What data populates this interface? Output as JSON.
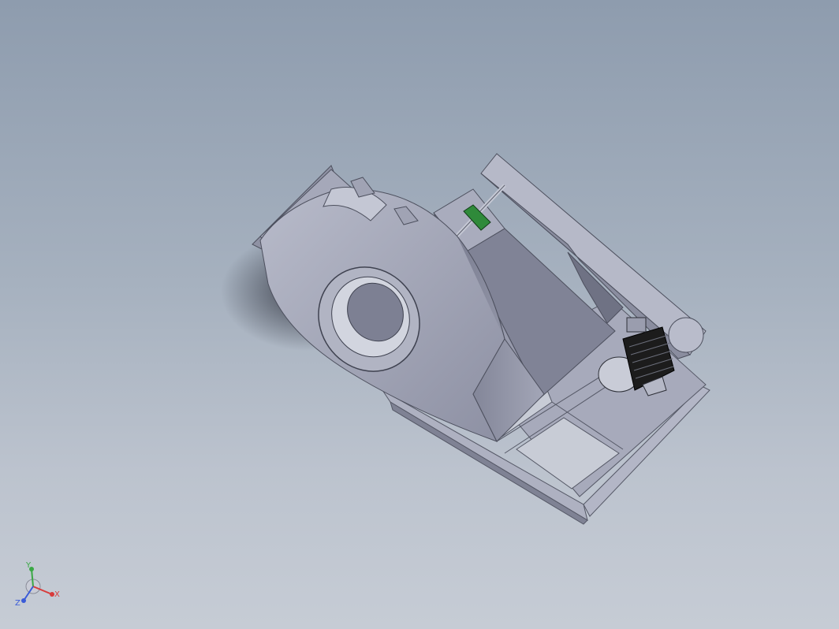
{
  "viewport": {
    "background_top": "#8e9cae",
    "background_bottom": "#c6ccd5"
  },
  "model": {
    "body_color": "#9a9dae",
    "body_dark": "#6e7082",
    "body_light": "#b9bccb",
    "bearing_color": "#2f8a3a",
    "motor_color": "#1c1c1c"
  },
  "triad": {
    "x_label": "X",
    "y_label": "Y",
    "z_label": "Z",
    "x_color": "#d83b3b",
    "y_color": "#3aa845",
    "z_color": "#3a5bd8"
  }
}
